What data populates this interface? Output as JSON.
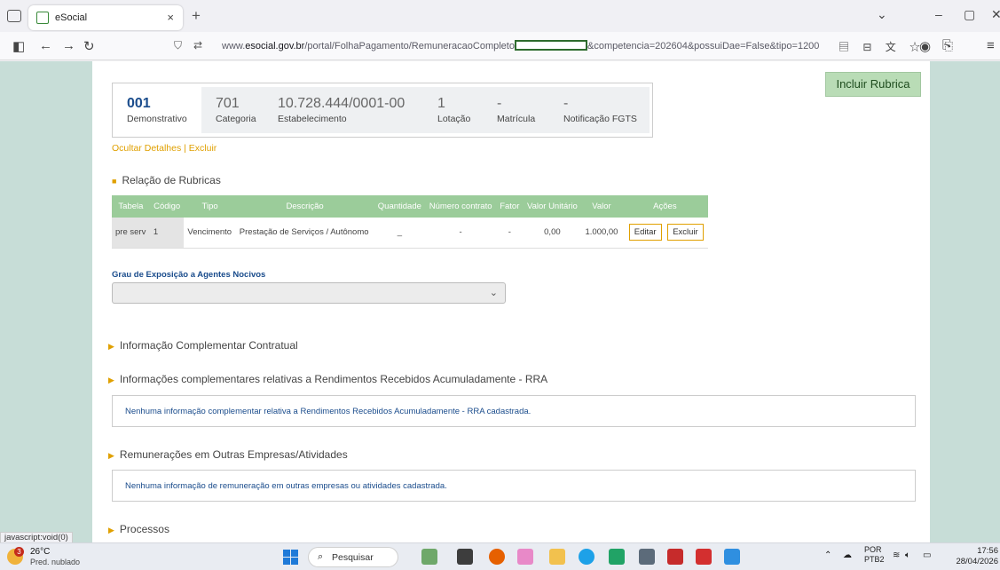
{
  "browser": {
    "tab_title": "eSocial",
    "tab_close": "×",
    "new_tab": "+",
    "url_prefix": "www.",
    "url_domain": "esocial.gov.br",
    "url_path": "/portal/FolhaPagamento/RemuneracaoCompleto",
    "url_suffix": "&competencia=202604&possuiDae=False&tipo=1200",
    "window_minimize": "–",
    "window_maximize": "▢",
    "window_close": "✕"
  },
  "page": {
    "incluir_rubrica": "Incluir Rubrica",
    "summary": {
      "demonstrativo_value": "001",
      "demonstrativo_label": "Demonstrativo",
      "categoria_value": "701",
      "categoria_label": "Categoria",
      "estabelecimento_value": "10.728.444/0001-00",
      "estabelecimento_label": "Estabelecimento",
      "lotacao_value": "1",
      "lotacao_label": "Lotação",
      "matricula_value": "-",
      "matricula_label": "Matrícula",
      "fgts_value": "-",
      "fgts_label": "Notificação FGTS"
    },
    "ocultar_detalhes": "Ocultar Detalhes",
    "separator": "|",
    "excluir_link": "Excluir",
    "relacao_title": "Relação de Rubricas",
    "table": {
      "headers": [
        "Tabela",
        "Código",
        "Tipo",
        "Descrição",
        "Quantidade",
        "Número contrato",
        "Fator",
        "Valor Unitário",
        "Valor",
        "Ações"
      ],
      "rows": [
        {
          "tabela": "pre serv",
          "codigo": "1",
          "tipo": "Vencimento",
          "descricao": "Prestação de Serviços / Autônomo",
          "quantidade": "_",
          "numero_contrato": "-",
          "fator": "-",
          "valor_unitario": "0,00",
          "valor": "1.000,00",
          "editar": "Editar",
          "excluir": "Excluir"
        }
      ]
    },
    "grau_label": "Grau de Exposição a Agentes Nocivos",
    "grau_value": "",
    "section_contratual": "Informação Complementar Contratual",
    "section_rra": "Informações complementares relativas a Rendimentos Recebidos Acumuladamente - RRA",
    "rra_empty": "Nenhuma informação complementar relativa a Rendimentos Recebidos Acumuladamente - RRA cadastrada.",
    "section_outras": "Remunerações em Outras Empresas/Atividades",
    "outras_empty": "Nenhuma informação de remuneração em outras empresas ou atividades cadastrada.",
    "section_processos": "Processos"
  },
  "status_link": "javascript:void(0)",
  "taskbar": {
    "weather_badge": "3",
    "temperature": "26°C",
    "condition": "Pred. nublado",
    "search_placeholder": "Pesquisar",
    "lang_top": "POR",
    "lang_bottom": "PTB2",
    "time": "17:56",
    "date": "28/04/2026"
  }
}
